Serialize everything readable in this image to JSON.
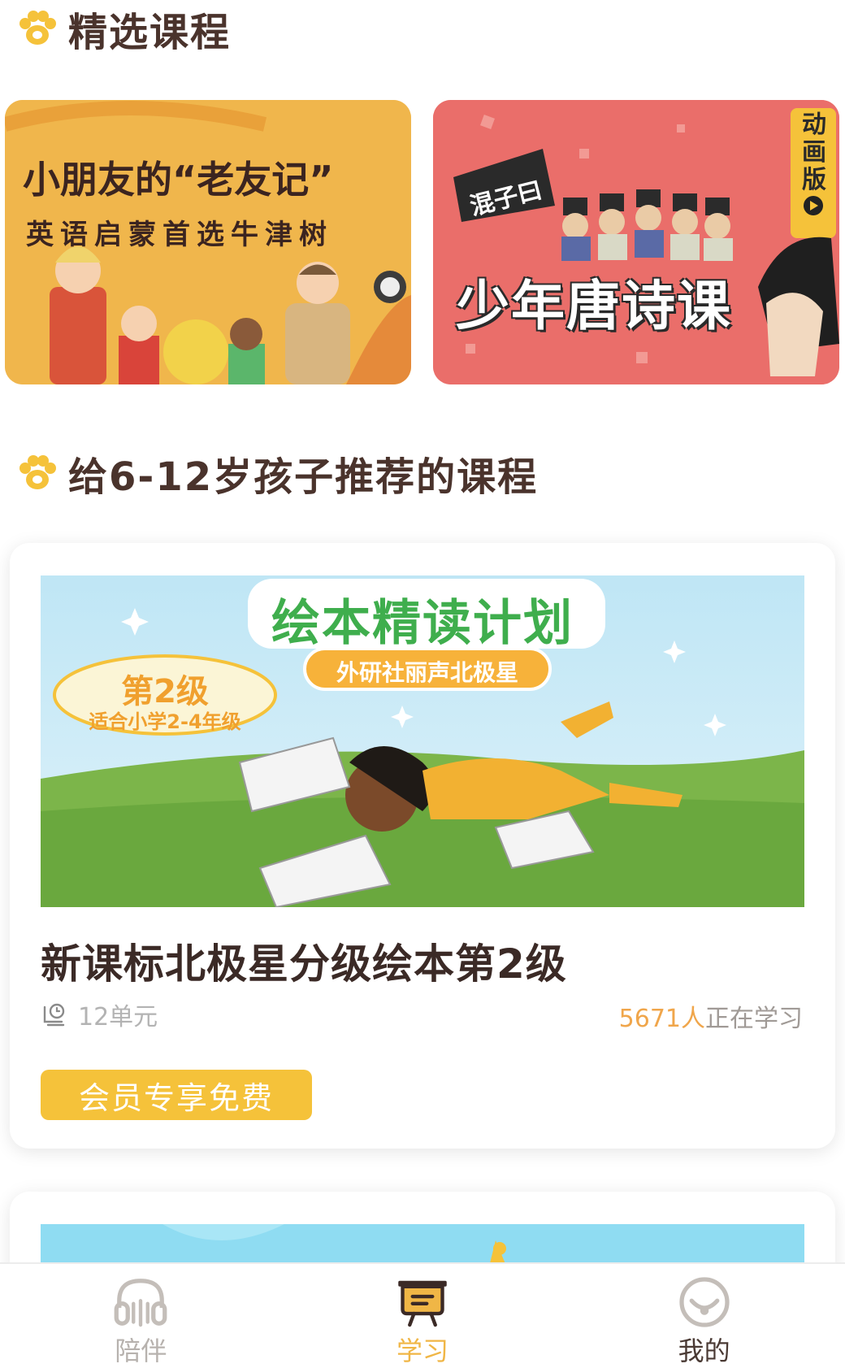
{
  "sections": {
    "featured_title": "精选课程",
    "recommend_title": "给6-12岁孩子推荐的课程"
  },
  "banners": [
    {
      "title": "小朋友的“老友记”",
      "subtitle": "英语启蒙首选牛津树"
    },
    {
      "tag": "混子曰",
      "title": "少年唐诗课",
      "badge": "动画版"
    }
  ],
  "course": {
    "image_title": "绘本精读计划",
    "image_publisher": "外研社丽声北极星",
    "image_level": "第2级",
    "image_grade": "适合小学2-4年级",
    "title": "新课标北极星分级绘本第2级",
    "units": "12单元",
    "learn_count": "5671人",
    "learn_text": "正在学习",
    "member_button": "会员专享免费"
  },
  "tabbar": {
    "items": [
      {
        "label": "陪伴",
        "icon": "headphones-icon"
      },
      {
        "label": "学习",
        "icon": "blackboard-icon",
        "active": true
      },
      {
        "label": "我的",
        "icon": "smiley-icon"
      }
    ]
  },
  "colors": {
    "accent": "#f5c23a",
    "learn_count": "#f0a64b",
    "tab_active": "#f0b646"
  }
}
